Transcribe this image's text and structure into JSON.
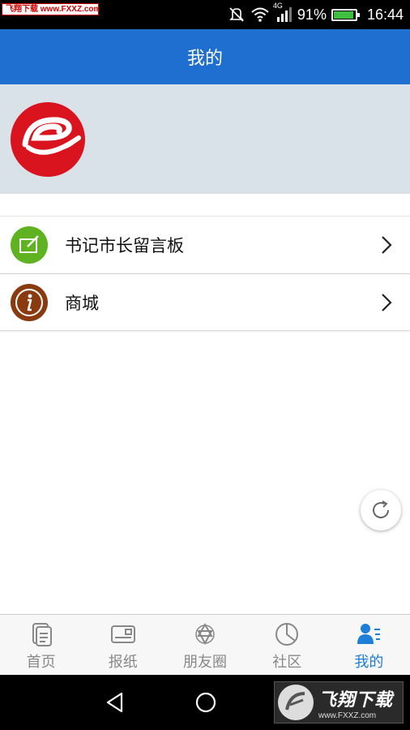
{
  "status_bar": {
    "watermark": "飞翔下载 www.FXXZ.com",
    "network": "4G",
    "battery": "91%",
    "battery_level": 0.91,
    "time": "16:44",
    "icons": [
      "mute-icon",
      "wifi-icon",
      "signal-icon",
      "battery-icon"
    ]
  },
  "title_bar": {
    "title": "我的"
  },
  "profile": {
    "avatar_icon": "app-logo-icon",
    "brand_color": "#d9141f"
  },
  "menu": {
    "items": [
      {
        "label": "书记市长留言板",
        "icon": "edit-note-icon",
        "icon_color": "#5fb321"
      },
      {
        "label": "商城",
        "icon": "info-icon",
        "icon_color": "#8b3a0f"
      }
    ]
  },
  "refresh": {
    "icon": "refresh-icon"
  },
  "tabs": [
    {
      "label": "首页",
      "icon": "document-icon",
      "active": false
    },
    {
      "label": "报纸",
      "icon": "newspaper-icon",
      "active": false
    },
    {
      "label": "朋友圈",
      "icon": "friends-circle-icon",
      "active": false
    },
    {
      "label": "社区",
      "icon": "pie-chart-icon",
      "active": false
    },
    {
      "label": "我的",
      "icon": "user-list-icon",
      "active": true
    }
  ],
  "nav": {
    "icons": [
      "back-icon",
      "home-icon"
    ]
  },
  "watermark_bottom": {
    "title": "飞翔下载",
    "url": "www.FXXZ.com"
  },
  "colors": {
    "primary": "#1e6fcf",
    "tab_active": "#1e7fd9",
    "tab_inactive": "#888888",
    "header_bg": "#d9e2e8"
  }
}
